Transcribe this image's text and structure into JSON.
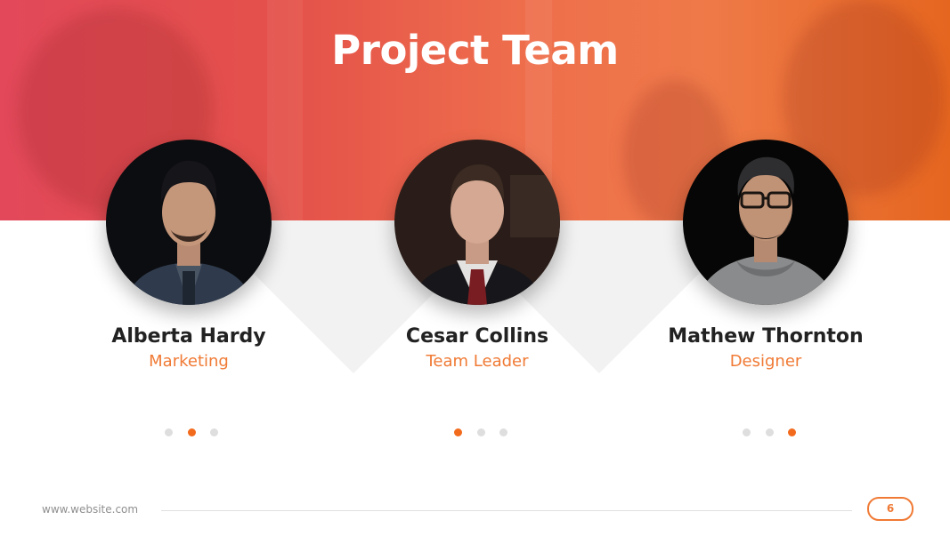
{
  "slide": {
    "title": "Project Team",
    "accent_color": "#f07a35",
    "active_dot_color": "#f26b1d",
    "inactive_dot_color": "#dedede"
  },
  "members": [
    {
      "name": "Alberta Hardy",
      "role": "Marketing",
      "photo": "portrait-man-dark-suit",
      "active_dot": 1
    },
    {
      "name": "Cesar Collins",
      "role": "Team Leader",
      "photo": "portrait-man-red-tie",
      "active_dot": 0
    },
    {
      "name": "Mathew Thornton",
      "role": "Designer",
      "photo": "portrait-man-glasses-hoodie",
      "active_dot": 2
    }
  ],
  "footer": {
    "website": "www.website.com",
    "page_number": "6"
  }
}
